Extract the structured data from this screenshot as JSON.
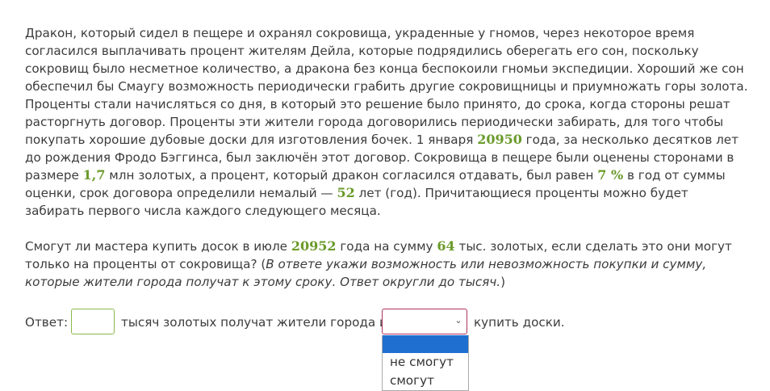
{
  "problem": {
    "p1_a": "Дракон, который сидел в пещере и охранял сокровища, украденные у гномов, через некоторое время согласился выплачивать процент жителям Дейла, которые подрядились оберегать его сон, поскольку сокровищ было несметное количество, а дракона без конца беспокоили гномьи экспедиции. Хороший же сон обеспечил бы Смаугу возможность периодически грабить другие сокровищницы и приумножать горы золота. Проценты стали начисляться со дня, в который это решение было принято, до срока, когда стороны решат расторгнуть договор. Проценты эти жители города договорились периодически забирать, для того чтобы покупать хорошие дубовые доски для изготовления бочек. 1 января ",
    "year1": "20950",
    "p1_b": " года, за несколько десятков лет до рождения Фродо Бэггинса, был заключён этот договор. Сокровища в пещере были оценены сторонами в размере ",
    "amount": "1,7",
    "p1_c": " млн золотых, а процент, который дракон согласился отдавать, был равен ",
    "percent": "7 %",
    "p1_d": " в год от суммы оценки, срок договора определили немалый — ",
    "years": "52",
    "p1_e": " лет (год). Причитающиеся проценты можно будет забирать первого числа каждого следующего месяца.",
    "p2_a": "Смогут ли мастера купить досок в июле ",
    "year2": "20952",
    "p2_b": " года на сумму ",
    "sum": "64",
    "p2_c": " тыс. золотых, если сделать это они могут только на проценты от сокровища? (",
    "hint": "В ответе укажи возможность или невозможность покупки и сумму, которые жители города получат к этому сроку. Ответ округли до тысяч.",
    "p2_d": ")"
  },
  "answer": {
    "label": "Ответ:",
    "input_value": "",
    "middle_text": "тысяч золотых получат жители города и",
    "select_value": "",
    "end_text": "купить доски."
  },
  "dropdown": {
    "options": [
      "",
      "не смогут",
      "смогут"
    ],
    "selected_index": 0
  },
  "colors": {
    "number": "#6a9a2a",
    "input_border": "#8cb84a",
    "select_border": "#b03060",
    "selected_option": "#1e6fd0"
  }
}
